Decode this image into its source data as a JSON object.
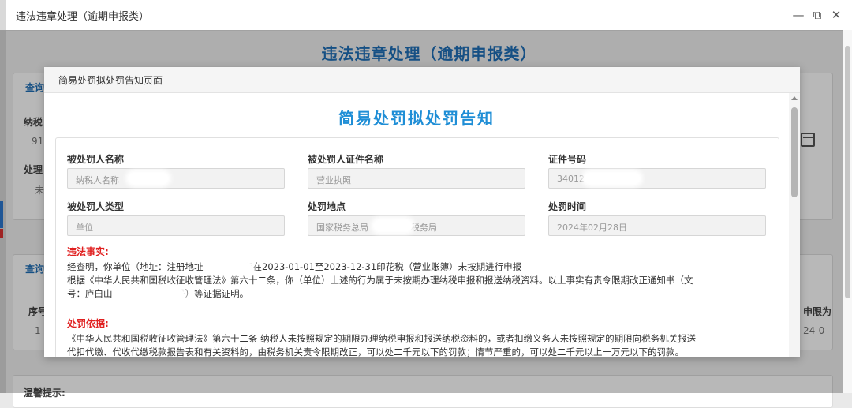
{
  "window": {
    "title": "违法违章处理（逾期申报类）",
    "controls": {
      "minimize": "—",
      "maximize": "⧉",
      "close": "✕"
    }
  },
  "background": {
    "heading": "违法违章处理（逾期申报类）",
    "labels": [
      "查询",
      "纳税",
      "91",
      "处理",
      "未",
      "查询",
      "序号",
      "1",
      "申限为",
      "24-0",
      "温馨提示:"
    ]
  },
  "modal": {
    "header_title": "简易处罚拟处罚告知页面",
    "main_title": "简易处罚拟处罚告知",
    "fields": {
      "punished_name": {
        "label": "被处罚人名称",
        "value": "纳税人名称"
      },
      "punished_cert_name": {
        "label": "被处罚人证件名称",
        "value": "营业执照"
      },
      "cert_number": {
        "label": "证件号码",
        "value": "34012"
      },
      "punished_type": {
        "label": "被处罚人类型",
        "value": "单位"
      },
      "punish_location": {
        "label": "处罚地点",
        "value": "国家税务总局",
        "value_suffix": "税务局"
      },
      "punish_time": {
        "label": "处罚时间",
        "value": "2024年02月28日"
      }
    },
    "facts": {
      "title": "违法事实:",
      "line1_a": "经查明，你单位（地址：注册地址",
      "line1_b": "）存在2023-01-01至2023-12-31印花税（营业账簿）未按期进行申报",
      "line2": "根据《中华人民共和国税收征收管理法》第六十二条，你（单位）上述的行为属于未按期办理纳税申报和报送纳税资料。以上事实有责令限期改正通知书（文",
      "line3_a": "号：庐白山",
      "line3_b": "18号）等证据证明。"
    },
    "basis": {
      "title": "处罚依据:",
      "line1": "《中华人民共和国税收征收管理法》第六十二条 纳税人未按照规定的期限办理纳税申报和报送纳税资料的，或者扣缴义务人未按照规定的期限向税务机关报送",
      "line2": "代扣代缴、代收代缴税款报告表和有关资料的，由税务机关责令限期改正，可以处二千元以下的罚款；情节严重的，可以处二千元以上一万元以下的罚款。"
    }
  },
  "colors": {
    "title_blue": "#1f8ed6",
    "section_red": "#e02020",
    "heading_blue": "#1f6fb8"
  }
}
